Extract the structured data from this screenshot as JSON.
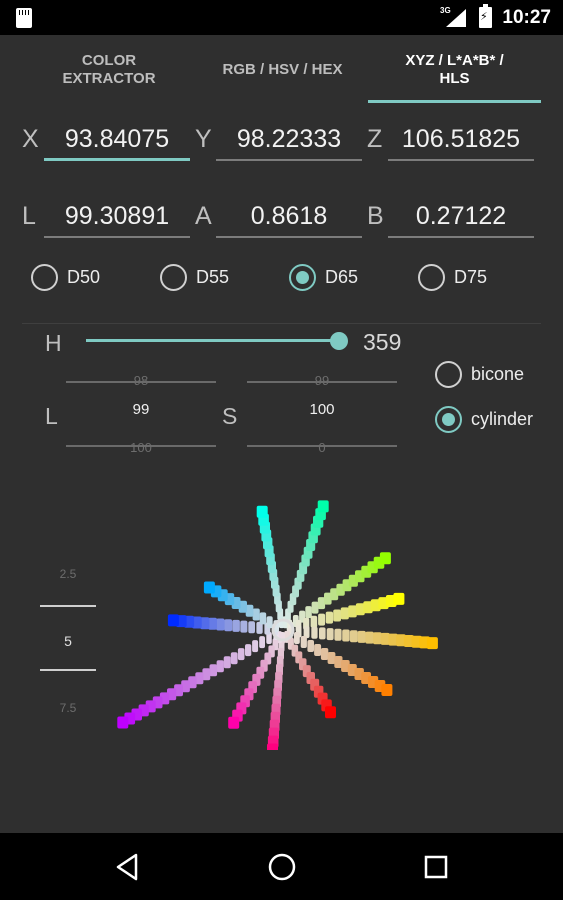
{
  "status_bar": {
    "network_type": "3G",
    "time": "10:27",
    "icons": [
      "sd-card-icon",
      "signal-icon",
      "battery-charging-icon"
    ]
  },
  "tabs": [
    {
      "label": "COLOR\nEXTRACTOR",
      "active": false
    },
    {
      "label": "RGB / HSV / HEX",
      "active": false
    },
    {
      "label": "XYZ / L*A*B* /\nHLS",
      "active": true
    }
  ],
  "xyz": {
    "x_label": "X",
    "x_value": "93.84075",
    "y_label": "Y",
    "y_value": "98.22333",
    "z_label": "Z",
    "z_value": "106.51825"
  },
  "lab": {
    "l_label": "L",
    "l_value": "99.30891",
    "a_label": "A",
    "a_value": "0.8618",
    "b_label": "B",
    "b_value": "0.27122"
  },
  "illuminants": {
    "options": [
      "D50",
      "D55",
      "D65",
      "D75"
    ],
    "selected": "D65"
  },
  "hls": {
    "h_label": "H",
    "h_value": "359",
    "h_fraction": 0.997,
    "l_label": "L",
    "l_prev": "98",
    "l_current": "99",
    "l_next": "100",
    "s_label": "S",
    "s_prev": "99",
    "s_current": "100",
    "s_next": "0"
  },
  "shape": {
    "options": [
      "bicone",
      "cylinder"
    ],
    "selected": "cylinder"
  },
  "scale_picker": {
    "prev": "2.5",
    "current": "5",
    "next": "7.5"
  },
  "accent_color": "#7fcac3",
  "navbar": {
    "icons": [
      "back-icon",
      "home-icon",
      "recents-icon"
    ]
  }
}
